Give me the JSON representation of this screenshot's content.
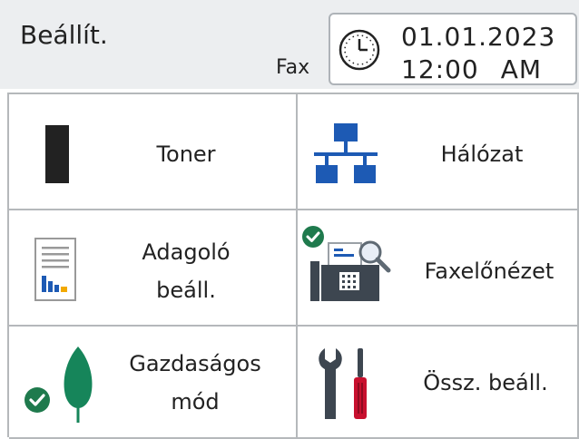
{
  "header": {
    "title": "Beállít.",
    "mode": "Fax",
    "date": "01.01.2023",
    "time": "12:00",
    "ampm": "AM"
  },
  "menu": {
    "toner": "Toner",
    "network": "Hálózat",
    "feeder_line1": "Adagoló",
    "feeder_line2": "beáll.",
    "fax_preview": "Faxelőnézet",
    "eco_line1": "Gazdaságos",
    "eco_line2": "mód",
    "all_settings": "Össz. beáll."
  },
  "icons": {
    "toner": "toner-cartridge-icon",
    "network": "network-icon",
    "feeder": "document-chart-icon",
    "fax_preview": "fax-preview-icon",
    "eco": "leaf-icon",
    "all_settings": "tools-icon",
    "clock": "clock-icon",
    "status_check": "checkmark-icon"
  },
  "colors": {
    "accent_blue": "#1d5ab4",
    "check_green": "#1f7a4d",
    "leaf_green": "#16855a",
    "dark": "#222222",
    "screwdriver_red": "#c8102e"
  },
  "status": {
    "fax_preview_enabled": true,
    "eco_mode_enabled": true
  }
}
